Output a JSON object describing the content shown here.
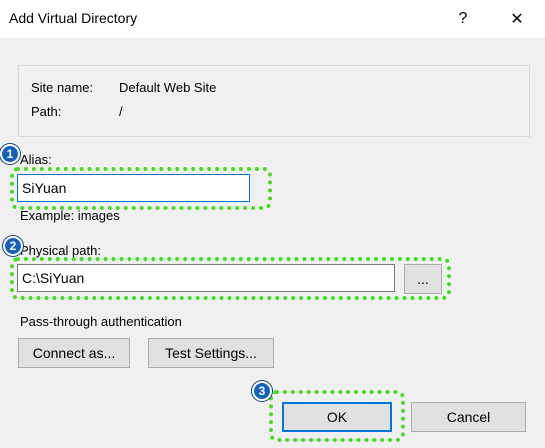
{
  "window": {
    "title": "Add Virtual Directory",
    "help_label": "?",
    "close_label": "✕"
  },
  "info": {
    "site_name_label": "Site name:",
    "site_name_value": "Default Web Site",
    "path_label": "Path:",
    "path_value": "/"
  },
  "alias": {
    "label": "Alias:",
    "value": "SiYuan",
    "example": "Example: images"
  },
  "physical_path": {
    "label": "Physical path:",
    "value": "C:\\SiYuan",
    "browse_label": "..."
  },
  "auth": {
    "label": "Pass-through authentication",
    "connect_as_label": "Connect as...",
    "test_settings_label": "Test Settings..."
  },
  "footer": {
    "ok_label": "OK",
    "cancel_label": "Cancel"
  },
  "annotations": {
    "badge_1": "1",
    "badge_2": "2",
    "badge_3": "3",
    "highlight_color": "#44dd22",
    "badge_color": "#1660c0"
  }
}
